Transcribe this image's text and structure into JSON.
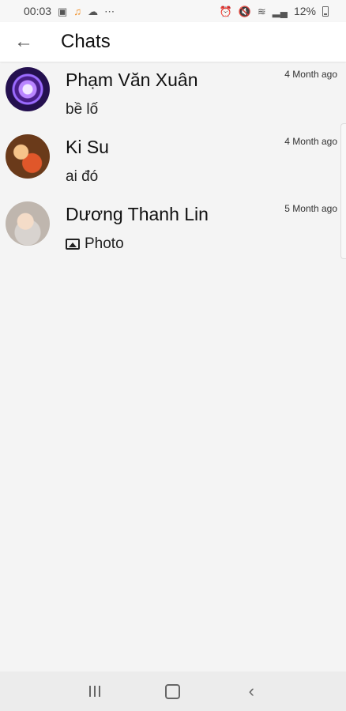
{
  "status_bar": {
    "time": "00:03",
    "battery": "12%"
  },
  "header": {
    "title": "Chats",
    "back_icon": "arrow-left-icon"
  },
  "chats": [
    {
      "name": "Phạm Văn Xuân",
      "preview": "bề lố",
      "time": "4 Month ago"
    },
    {
      "name": "Ki Su",
      "preview": "ai đó",
      "time": "4 Month ago"
    },
    {
      "name": "Dương Thanh Lin",
      "preview": "Photo",
      "time": "5 Month ago",
      "preview_icon": "photo-icon"
    }
  ],
  "nav": {
    "recents": "recents-icon",
    "home": "home-icon",
    "back": "back-icon"
  }
}
